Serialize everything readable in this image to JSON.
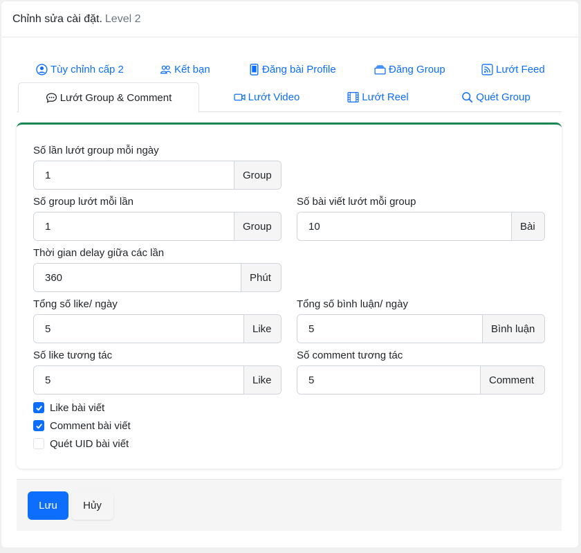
{
  "header": {
    "title": "Chỉnh sửa cài đặt.",
    "level": "Level 2"
  },
  "tabs_row1": [
    {
      "label": "Tùy chỉnh cấp 2",
      "icon": "user-circle-icon"
    },
    {
      "label": "Kết bạn",
      "icon": "people-icon"
    },
    {
      "label": "Đăng bài Profile",
      "icon": "phone-icon"
    },
    {
      "label": "Đăng Group",
      "icon": "layers-icon"
    },
    {
      "label": "Lướt Feed",
      "icon": "rss-icon"
    }
  ],
  "tabs_row2": [
    {
      "label": "Lướt Group & Comment",
      "icon": "chat-dots-icon",
      "active": true
    },
    {
      "label": "Lướt Video",
      "icon": "camera-video-icon"
    },
    {
      "label": "Lướt Reel",
      "icon": "film-icon"
    },
    {
      "label": "Quét Group",
      "icon": "search-icon"
    }
  ],
  "fields": {
    "scroll_group_per_day": {
      "label": "Số lần lướt group mỗi ngày",
      "value": "1",
      "unit": "Group"
    },
    "groups_per_time": {
      "label": "Số group lướt mỗi lần",
      "value": "1",
      "unit": "Group"
    },
    "posts_per_group": {
      "label": "Số bài viết lướt mỗi group",
      "value": "10",
      "unit": "Bài"
    },
    "delay": {
      "label": "Thời gian delay giữa các lần",
      "value": "360",
      "unit": "Phút"
    },
    "total_likes": {
      "label": "Tổng số like/ ngày",
      "value": "5",
      "unit": "Like"
    },
    "total_comments": {
      "label": "Tổng số bình luận/ ngày",
      "value": "5",
      "unit": "Bình luận"
    },
    "interact_likes": {
      "label": "Số like tương tác",
      "value": "5",
      "unit": "Like"
    },
    "interact_comments": {
      "label": "Số comment tương tác",
      "value": "5",
      "unit": "Comment"
    }
  },
  "checkboxes": [
    {
      "label": "Like bài viết",
      "checked": true
    },
    {
      "label": "Comment bài viết",
      "checked": true
    },
    {
      "label": "Quét UID bài viết",
      "checked": false
    }
  ],
  "footer": {
    "save_label": "Lưu",
    "cancel_label": "Hủy"
  },
  "colors": {
    "primary": "#0d6efd",
    "panel_accent": "#198754"
  }
}
